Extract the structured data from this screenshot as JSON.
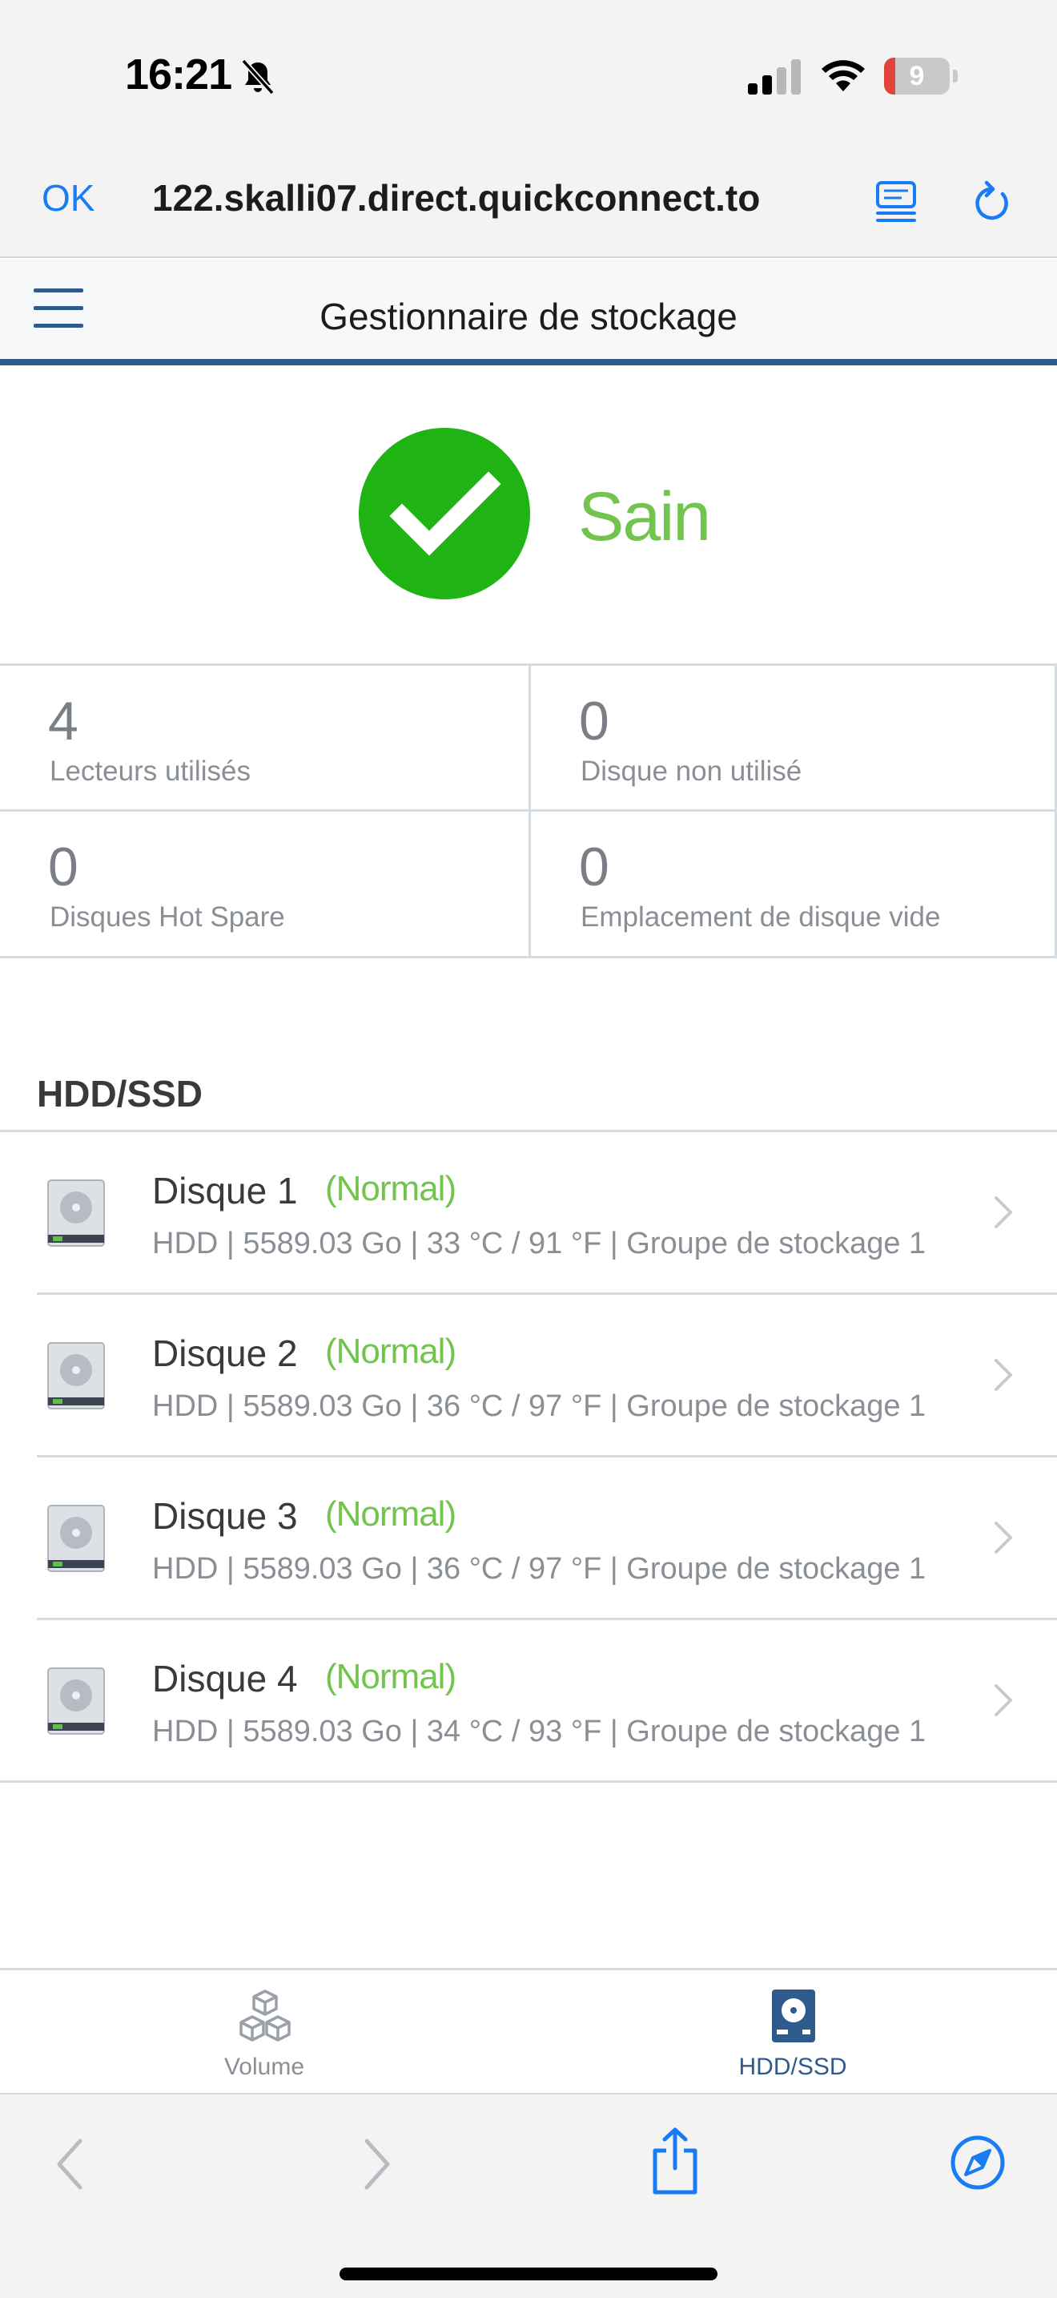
{
  "status_bar": {
    "time": "16:21",
    "battery_level": "9",
    "icons": [
      "bell-slash-icon",
      "signal-icon",
      "wifi-icon",
      "battery-icon"
    ]
  },
  "browser": {
    "ok_label": "OK",
    "url": "122.skalli07.direct.quickconnect.to",
    "icons": [
      "reader-icon",
      "reload-icon"
    ]
  },
  "app": {
    "title": "Gestionnaire de stockage"
  },
  "health": {
    "status": "Sain",
    "color": "#1fb313"
  },
  "stats": [
    {
      "value": "4",
      "label": "Lecteurs utilisés"
    },
    {
      "value": "0",
      "label": "Disque non utilisé"
    },
    {
      "value": "0",
      "label": "Disques Hot Spare"
    },
    {
      "value": "0",
      "label": "Emplacement de disque vide"
    }
  ],
  "section": {
    "title": "HDD/SSD"
  },
  "disks": [
    {
      "name": "Disque 1",
      "status": "(Normal)",
      "detail": "HDD | 5589.03 Go | 33 °C / 91 °F | Groupe de stockage 1"
    },
    {
      "name": "Disque 2",
      "status": "(Normal)",
      "detail": "HDD | 5589.03 Go | 36 °C / 97 °F | Groupe de stockage 1"
    },
    {
      "name": "Disque 3",
      "status": "(Normal)",
      "detail": "HDD | 5589.03 Go | 36 °C / 97 °F | Groupe de stockage 1"
    },
    {
      "name": "Disque 4",
      "status": "(Normal)",
      "detail": "HDD | 5589.03 Go | 34 °C / 93 °F | Groupe de stockage 1"
    }
  ],
  "tabs": [
    {
      "label": "Volume",
      "icon": "cubes-icon",
      "active": false
    },
    {
      "label": "HDD/SSD",
      "icon": "hdd-icon",
      "active": true
    }
  ],
  "colors": {
    "accent": "#2e5a8c",
    "ios_blue": "#1a7cf5",
    "healthy_green": "#72c44d"
  },
  "safari_toolbar": {
    "icons": [
      "back-icon",
      "forward-icon",
      "share-icon",
      "compass-icon"
    ]
  }
}
